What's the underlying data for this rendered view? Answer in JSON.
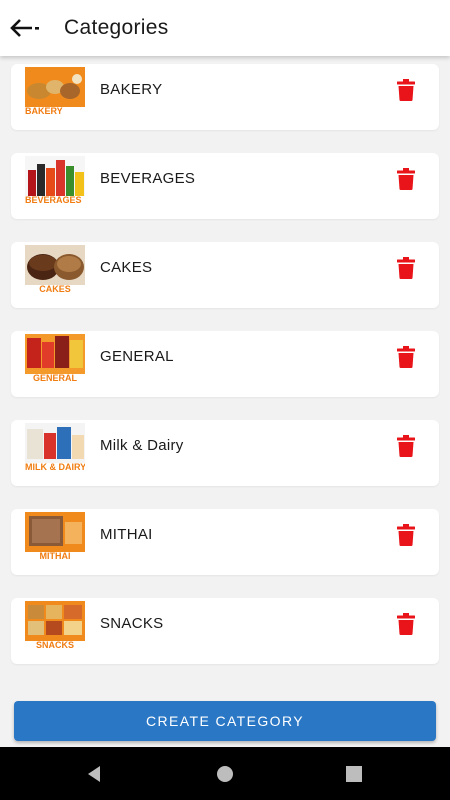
{
  "header": {
    "title": "Categories"
  },
  "categories": [
    {
      "name": "BAKERY",
      "image_label": "BAKERY"
    },
    {
      "name": "BEVERAGES",
      "image_label": "BEVERAGES"
    },
    {
      "name": "CAKES",
      "image_label": "CAKES"
    },
    {
      "name": "GENERAL",
      "image_label": "GENERAL"
    },
    {
      "name": "Milk & Dairy",
      "image_label": "MILK & DAIRY"
    },
    {
      "name": "MITHAI",
      "image_label": "MITHAI"
    },
    {
      "name": "SNACKS",
      "image_label": "SNACKS"
    }
  ],
  "actions": {
    "create_label": "CREATE CATEGORY"
  },
  "colors": {
    "accent": "#2a77c5",
    "delete": "#e8141a",
    "thumb_orange": "#f07c12"
  },
  "icons": {
    "back": "arrow-left-icon",
    "delete": "trash-icon",
    "nav": [
      "back-triangle-icon",
      "home-circle-icon",
      "recents-square-icon"
    ]
  }
}
